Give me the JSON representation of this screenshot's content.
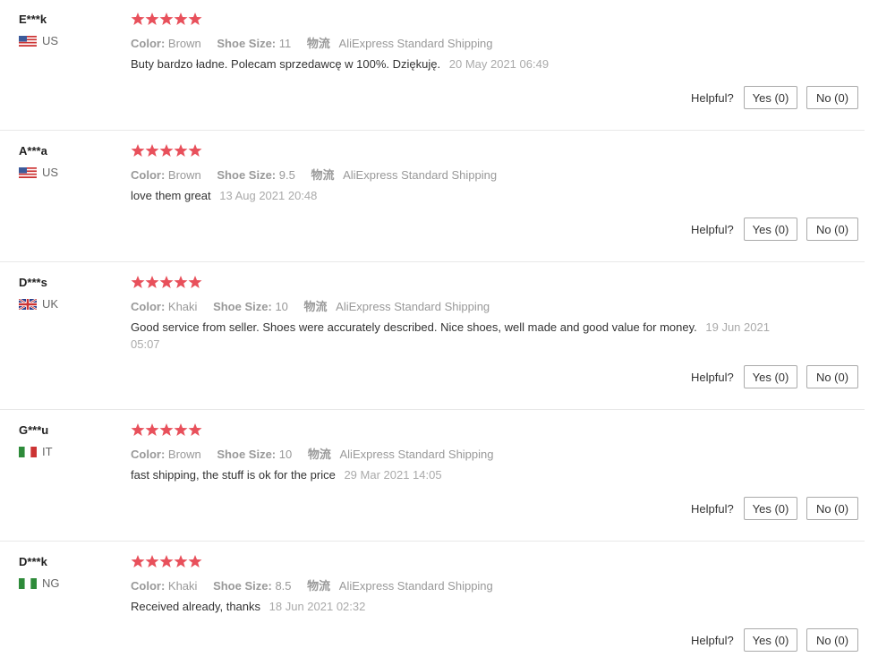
{
  "labels": {
    "color_label": "Color:",
    "size_label": "Shoe Size:",
    "logistics_label": "物流",
    "helpful": "Helpful?",
    "yes": "Yes (0)",
    "no": "No (0)"
  },
  "reviews": [
    {
      "user": "E***k",
      "country": "US",
      "flag": "us",
      "stars": 5,
      "color": "Brown",
      "size": "11",
      "shipping": "AliExpress Standard Shipping",
      "text": "Buty bardzo ładne. Polecam sprzedawcę w 100%. Dziękuję.",
      "date": "20 May 2021 06:49"
    },
    {
      "user": "A***a",
      "country": "US",
      "flag": "us",
      "stars": 5,
      "color": "Brown",
      "size": "9.5",
      "shipping": "AliExpress Standard Shipping",
      "text": "love them great",
      "date": "13 Aug 2021 20:48"
    },
    {
      "user": "D***s",
      "country": "UK",
      "flag": "uk",
      "stars": 5,
      "color": "Khaki",
      "size": "10",
      "shipping": "AliExpress Standard Shipping",
      "text": "Good service from seller. Shoes were accurately described. Nice shoes, well made and good value for money.",
      "date": "19 Jun 2021 05:07"
    },
    {
      "user": "G***u",
      "country": "IT",
      "flag": "it",
      "stars": 5,
      "color": "Brown",
      "size": "10",
      "shipping": "AliExpress Standard Shipping",
      "text": "fast shipping, the stuff is ok for the price",
      "date": "29 Mar 2021 14:05"
    },
    {
      "user": "D***k",
      "country": "NG",
      "flag": "ng",
      "stars": 5,
      "color": "Khaki",
      "size": "8.5",
      "shipping": "AliExpress Standard Shipping",
      "text": "Received already, thanks",
      "date": "18 Jun 2021 02:32"
    }
  ],
  "colors": {
    "star": "#e8505b",
    "divider": "#e8e8e8"
  }
}
